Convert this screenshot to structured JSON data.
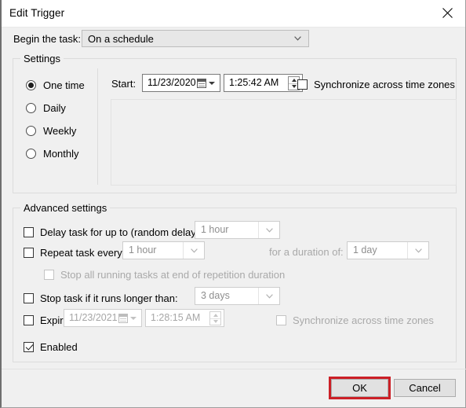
{
  "window": {
    "title": "Edit Trigger",
    "close_icon": "close-icon"
  },
  "begin_task": {
    "label": "Begin the task:",
    "value": "On a schedule"
  },
  "settings": {
    "group_title": "Settings",
    "schedule_options": [
      {
        "label": "One time",
        "selected": true
      },
      {
        "label": "Daily",
        "selected": false
      },
      {
        "label": "Weekly",
        "selected": false
      },
      {
        "label": "Monthly",
        "selected": false
      }
    ],
    "start_label": "Start:",
    "start_date": "11/23/2020",
    "start_time": "1:25:42 AM",
    "sync_label": "Synchronize across time zones",
    "sync_checked": false
  },
  "advanced": {
    "group_title": "Advanced settings",
    "delay": {
      "label": "Delay task for up to (random delay):",
      "checked": false,
      "value": "1 hour"
    },
    "repeat": {
      "label": "Repeat task every:",
      "checked": false,
      "value": "1 hour",
      "duration_label": "for a duration of:",
      "duration_value": "1 day"
    },
    "stop_all": {
      "label": "Stop all running tasks at end of repetition duration",
      "checked": false
    },
    "stop_longer": {
      "label": "Stop task if it runs longer than:",
      "checked": false,
      "value": "3 days"
    },
    "expire": {
      "label": "Expire:",
      "checked": false,
      "date": "11/23/2021",
      "time": "1:28:15 AM",
      "sync_label": "Synchronize across time zones",
      "sync_checked": false
    },
    "enabled": {
      "label": "Enabled",
      "checked": true
    }
  },
  "footer": {
    "ok_label": "OK",
    "cancel_label": "Cancel",
    "highlight_color": "#cc2027"
  }
}
